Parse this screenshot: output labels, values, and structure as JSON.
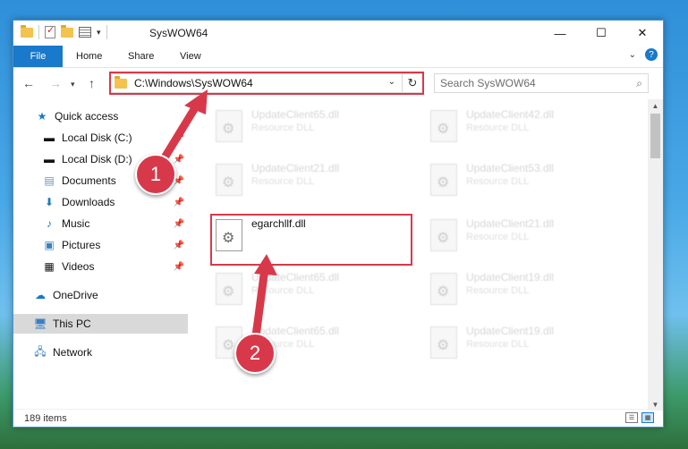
{
  "window": {
    "title": "SysWOW64",
    "controls": {
      "minimize": "—",
      "maximize": "☐",
      "close": "✕"
    }
  },
  "ribbon": {
    "tabs": [
      "File",
      "Home",
      "Share",
      "View"
    ]
  },
  "address_bar": {
    "path": "C:\\Windows\\SysWOW64"
  },
  "search": {
    "placeholder": "Search SysWOW64"
  },
  "nav_pane": {
    "items": [
      {
        "label": "Quick access",
        "icon": "star-icon"
      },
      {
        "label": "Local Disk (C:)",
        "icon": "drive-icon",
        "pinned": true
      },
      {
        "label": "Local Disk (D:)",
        "icon": "drive-icon",
        "pinned": true
      },
      {
        "label": "Documents",
        "icon": "documents-icon",
        "pinned": true
      },
      {
        "label": "Downloads",
        "icon": "download-icon",
        "pinned": true
      },
      {
        "label": "Music",
        "icon": "music-icon",
        "pinned": true
      },
      {
        "label": "Pictures",
        "icon": "pictures-icon",
        "pinned": true
      },
      {
        "label": "Videos",
        "icon": "videos-icon",
        "pinned": true
      },
      {
        "label": "OneDrive",
        "icon": "cloud-icon"
      },
      {
        "label": "This PC",
        "icon": "computer-icon",
        "selected": true
      },
      {
        "label": "Network",
        "icon": "network-icon"
      }
    ]
  },
  "files": [
    {
      "name": "UpdateClient65.dll",
      "type": "Resource DLL"
    },
    {
      "name": "UpdateClient42.dll",
      "type": "Resource DLL"
    },
    {
      "name": "UpdateClient21.dll",
      "type": "Resource DLL"
    },
    {
      "name": "UpdateClient53.dll",
      "type": "Resource DLL"
    },
    {
      "name": "egarchllf.dll",
      "type": ""
    },
    {
      "name": "UpdateClient21.dll",
      "type": "Resource DLL"
    },
    {
      "name": "UpdateClient65.dll",
      "type": "Resource DLL"
    },
    {
      "name": "UpdateClient19.dll",
      "type": "Resource DLL"
    },
    {
      "name": "UpdateClient65.dll",
      "type": "Resource DLL"
    },
    {
      "name": "UpdateClient19.dll",
      "type": "Resource DLL"
    }
  ],
  "status": {
    "item_count": "189 items"
  },
  "callouts": {
    "one": "1",
    "two": "2"
  },
  "colors": {
    "accent": "#1979ca",
    "callout_red": "#d8394a"
  }
}
